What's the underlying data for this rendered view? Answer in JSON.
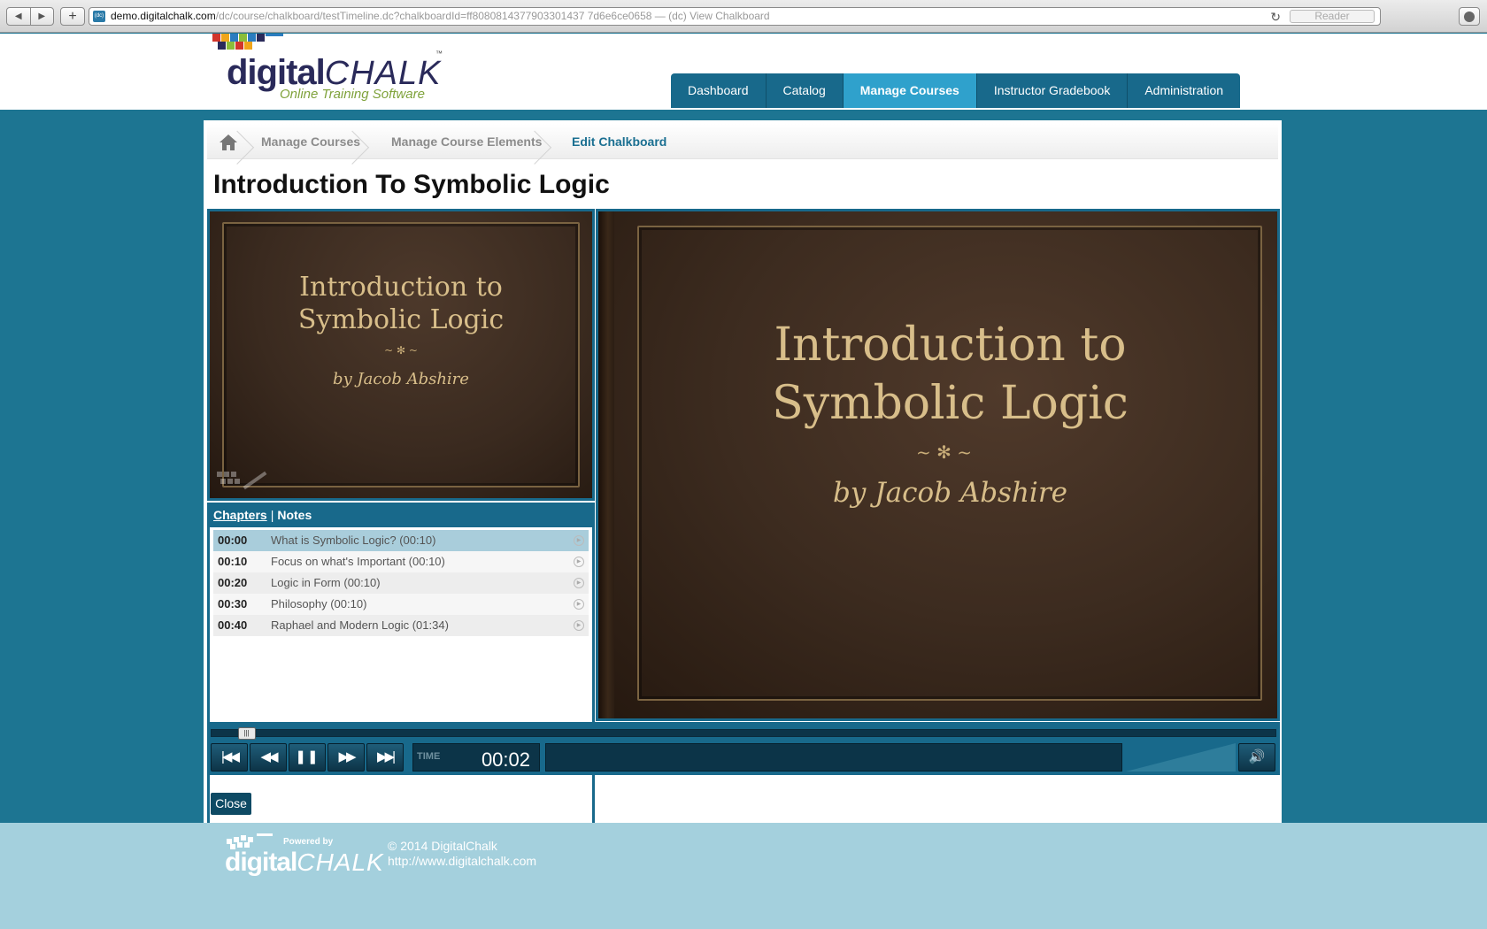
{
  "browser": {
    "back_label": "◀",
    "forward_label": "▶",
    "new_tab_label": "+",
    "url_host": "demo.digitalchalk.com",
    "url_path": "/dc/course/chalkboard/testTimeline.dc?chalkboardId=ff8080814377903301437 7d6e6ce0658",
    "page_title_suffix": " — (dc) View Chalkboard",
    "reader_label": "Reader",
    "favicon_text": "(dc)"
  },
  "logo": {
    "word_plain": "digital",
    "word_italic": "CHALK",
    "tagline": "Online Training Software",
    "tm": "™"
  },
  "nav": {
    "tabs": [
      {
        "label": "Dashboard",
        "active": false
      },
      {
        "label": "Catalog",
        "active": false
      },
      {
        "label": "Manage Courses",
        "active": true
      },
      {
        "label": "Instructor Gradebook",
        "active": false
      },
      {
        "label": "Administration",
        "active": false
      }
    ]
  },
  "breadcrumb": {
    "items": [
      "Manage Courses",
      "Manage Course Elements",
      "Edit Chalkboard"
    ]
  },
  "page": {
    "title": "Introduction To Symbolic Logic"
  },
  "slide": {
    "title_line1": "Introduction to",
    "title_line2": "Symbolic Logic",
    "ornament": "~ ✻ ~",
    "byline": "by Jacob Abshire"
  },
  "chapters_panel": {
    "tab_chapters": "Chapters",
    "separator": "|",
    "tab_notes": "Notes",
    "rows": [
      {
        "time": "00:00",
        "title": "What is Symbolic Logic? (00:10)",
        "active": true
      },
      {
        "time": "00:10",
        "title": "Focus on what's Important (00:10)",
        "active": false
      },
      {
        "time": "00:20",
        "title": "Logic in Form (00:10)",
        "active": false
      },
      {
        "time": "00:30",
        "title": "Philosophy (00:10)",
        "active": false
      },
      {
        "time": "00:40",
        "title": "Raphael and Modern Logic (01:34)",
        "active": false
      }
    ]
  },
  "player": {
    "progress": 0.02,
    "time_label": "TIME",
    "time_value": "00:02",
    "buttons": {
      "skip_back": "skip-to-start-icon",
      "rewind": "rewind-icon",
      "pause": "pause-icon",
      "forward": "fast-forward-icon",
      "skip_end": "skip-to-end-icon",
      "volume": "volume-icon"
    }
  },
  "close_button": "Close",
  "footer": {
    "powered_by": "Powered by",
    "word_plain": "digital",
    "word_italic": "CHALK",
    "copyright": "© 2014 DigitalChalk",
    "url": "http://www.digitalchalk.com"
  },
  "colors": {
    "brand_teal": "#18698b",
    "active_tab": "#2fa1cc",
    "page_bg": "#1d7592",
    "footer_bg": "#a4d0dd",
    "slide_gold": "#d8be8a",
    "slide_brown": "#3a2a1f"
  }
}
